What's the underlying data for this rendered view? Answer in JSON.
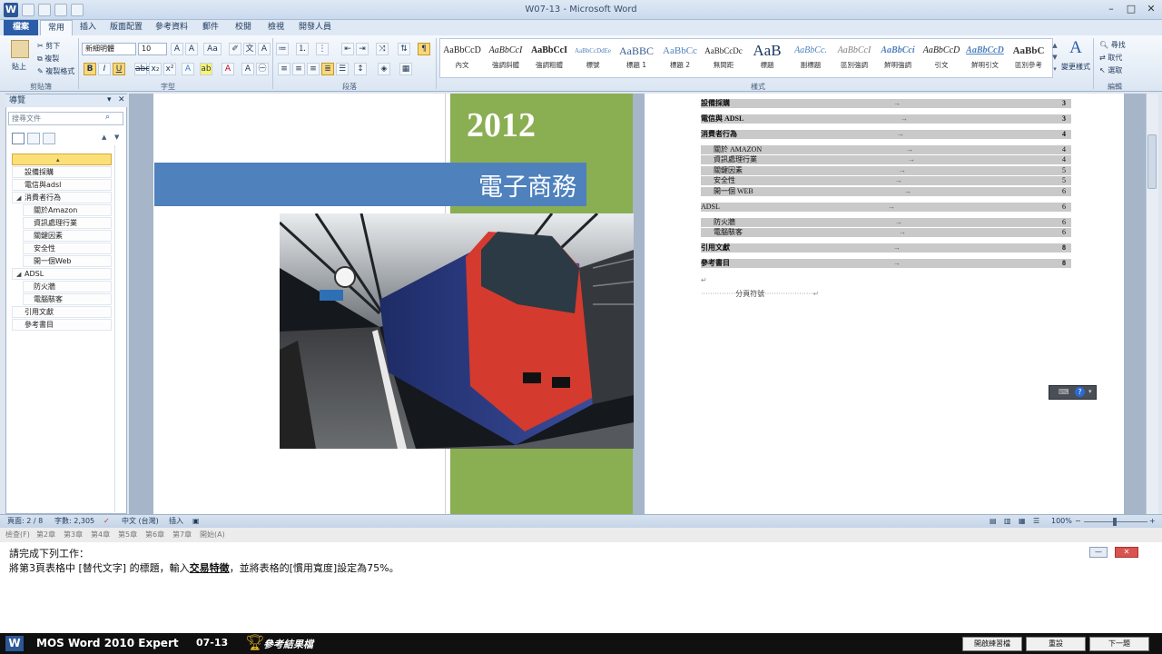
{
  "window": {
    "title": "W07-13 - Microsoft Word",
    "icon": "word-icon"
  },
  "tabs": [
    "檔案",
    "常用",
    "插入",
    "版面配置",
    "參考資料",
    "郵件",
    "校閱",
    "檢視",
    "開發人員"
  ],
  "ribbon": {
    "clipboard": {
      "label": "剪貼簿",
      "paste": "貼上",
      "cut": "剪下",
      "copy": "複製",
      "format_painter": "複製格式"
    },
    "font": {
      "label": "字型",
      "name": "新細明體",
      "size": "10",
      "bold": "B",
      "italic": "I",
      "underline": "U"
    },
    "paragraph": {
      "label": "段落"
    },
    "styles": {
      "label": "樣式",
      "change_styles": "變更樣式",
      "items": [
        {
          "sample": "AaBbCcD",
          "name": "內文"
        },
        {
          "sample": "AaBbCcI",
          "name": "強調斜體"
        },
        {
          "sample": "AaBbCcI",
          "name": "強調粗體"
        },
        {
          "sample": "AaBbCcDdEe",
          "name": "標號"
        },
        {
          "sample": "AaBBC",
          "name": "標題 1"
        },
        {
          "sample": "AaBbCc",
          "name": "標題 2"
        },
        {
          "sample": "AaBbCcDc",
          "name": "無間距"
        },
        {
          "sample": "AaB",
          "name": "標題"
        },
        {
          "sample": "AaBbCc.",
          "name": "副標題"
        },
        {
          "sample": "AaBbCcI",
          "name": "區別強調"
        },
        {
          "sample": "AaBbCci",
          "name": "鮮明強調"
        },
        {
          "sample": "AaBbCcD",
          "name": "引文"
        },
        {
          "sample": "AaBbCcD",
          "name": "鮮明引文"
        },
        {
          "sample": "AaBbC",
          "name": "區別參考"
        }
      ]
    },
    "editing": {
      "label": "編輯",
      "find": "尋找",
      "replace": "取代",
      "select": "選取"
    }
  },
  "nav": {
    "title": "導覽",
    "search_placeholder": "搜尋文件",
    "items": [
      {
        "label": "",
        "level": 1,
        "selected": true
      },
      {
        "label": "設備採購",
        "level": 1
      },
      {
        "label": "電信與adsl",
        "level": 1
      },
      {
        "label": "消費者行為",
        "level": 1,
        "expanded": true
      },
      {
        "label": "關於Amazon",
        "level": 2
      },
      {
        "label": "資訊處理行業",
        "level": 2
      },
      {
        "label": "關鍵因素",
        "level": 2
      },
      {
        "label": "安全性",
        "level": 2
      },
      {
        "label": "開一個Web",
        "level": 2
      },
      {
        "label": "ADSL",
        "level": 1,
        "expanded": true
      },
      {
        "label": "防火牆",
        "level": 2
      },
      {
        "label": "電腦駭客",
        "level": 2
      },
      {
        "label": "引用文獻",
        "level": 1
      },
      {
        "label": "參考書目",
        "level": 1
      }
    ]
  },
  "cover": {
    "year": "2012",
    "title": "電子商務"
  },
  "toc": [
    {
      "text": "設備採購",
      "page": "3",
      "level": 1
    },
    {
      "text": "電信與 ADSL",
      "page": "3",
      "level": 1
    },
    {
      "text": "消費者行為",
      "page": "4",
      "level": 1
    },
    {
      "text": "關於 AMAZON",
      "page": "4",
      "level": 2
    },
    {
      "text": "資訊處理行業",
      "page": "4",
      "level": 2
    },
    {
      "text": "關鍵因素",
      "page": "5",
      "level": 2
    },
    {
      "text": "安全性",
      "page": "5",
      "level": 2
    },
    {
      "text": "開一個 WEB",
      "page": "6",
      "level": 2
    },
    {
      "text": "ADSL",
      "page": "6",
      "level": 1
    },
    {
      "text": "防火牆",
      "page": "6",
      "level": 2
    },
    {
      "text": "電腦駭客",
      "page": "6",
      "level": 2
    },
    {
      "text": "引用文獻",
      "page": "8",
      "level": 1
    },
    {
      "text": "參考書目",
      "page": "8",
      "level": 1
    }
  ],
  "page_break_label": "分頁符號",
  "status": {
    "page": "頁面: 2 / 8",
    "words": "字數: 2,305",
    "language": "中文 (台灣)",
    "mode": "插入",
    "zoom": "100%"
  },
  "task_strip": [
    "檢查(F)",
    "第2章",
    "第3章",
    "第4章",
    "第5章",
    "第6章",
    "第7章",
    "開始(A)"
  ],
  "task": {
    "heading": "請完成下列工作：",
    "line_pre": "將第3頁表格中 [替代文字] 的標題，輸入",
    "line_bold": "交易特徵",
    "line_post": "，並將表格的[慣用寬度]設定為75%。"
  },
  "bottom": {
    "product": "MOS Word 2010 Expert",
    "code": "07-13",
    "result_label": "參考結果檔",
    "btn_practice": "開啟練習檔",
    "btn_reset": "重設",
    "btn_next": "下一題"
  }
}
